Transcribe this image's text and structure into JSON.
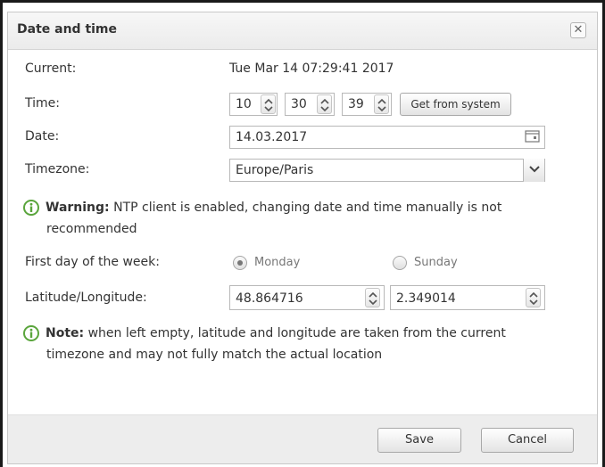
{
  "dialog": {
    "title": "Date and time",
    "close_icon": "close-icon"
  },
  "current": {
    "label": "Current:",
    "value": "Tue Mar 14 07:29:41 2017"
  },
  "time": {
    "label": "Time:",
    "hours": "10",
    "minutes": "30",
    "seconds": "39",
    "get_from_system_label": "Get from system"
  },
  "date": {
    "label": "Date:",
    "value": "14.03.2017",
    "icon": "calendar-icon"
  },
  "timezone": {
    "label": "Timezone:",
    "value": "Europe/Paris"
  },
  "warning": {
    "bold": "Warning:",
    "line1": " NTP client is enabled, changing date and time manually is not",
    "line2": "recommended"
  },
  "first_day": {
    "label": "First day of the week:",
    "options": [
      {
        "label": "Monday",
        "selected": true
      },
      {
        "label": "Sunday",
        "selected": false
      }
    ]
  },
  "latlon": {
    "label": "Latitude/Longitude:",
    "latitude": "48.864716",
    "longitude": "2.349014"
  },
  "note": {
    "bold": "Note:",
    "line1": " when left empty, latitude and longitude are taken from the current",
    "line2": "timezone and may not fully match the actual location"
  },
  "footer": {
    "save_label": "Save",
    "cancel_label": "Cancel"
  },
  "colors": {
    "info_green": "#5aa53c",
    "footer_bg": "#ededed"
  }
}
